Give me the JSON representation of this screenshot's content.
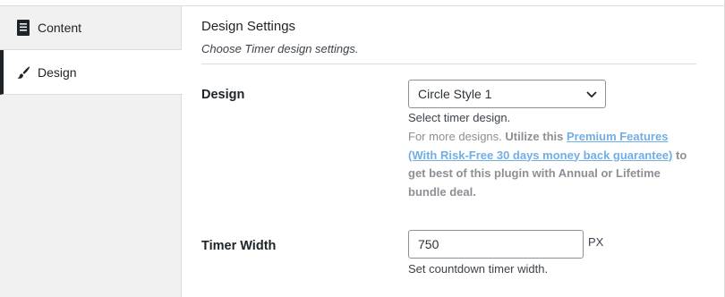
{
  "sidebar": {
    "items": [
      {
        "label": "Content",
        "icon": "document-icon"
      },
      {
        "label": "Design",
        "icon": "brush-icon",
        "active": true
      }
    ]
  },
  "section": {
    "title": "Design Settings",
    "description": "Choose Timer design settings."
  },
  "design_field": {
    "label": "Design",
    "selected": "Circle Style 1",
    "help": "Select timer design.",
    "note_prefix": "For more designs. ",
    "note_bold": "Utilize this ",
    "note_link": "Premium Features (With Risk-Free 30 days money back guarantee)",
    "note_suffix": "to get best of this plugin with Annual or Lifetime bundle deal."
  },
  "width_field": {
    "label": "Timer Width",
    "value": "750",
    "unit": "PX",
    "help": "Set countdown timer width."
  },
  "colors": {
    "accent_link": "#72aee6",
    "sidebar_bg": "#f1f1f1",
    "active_indicator": "#1d2327"
  }
}
